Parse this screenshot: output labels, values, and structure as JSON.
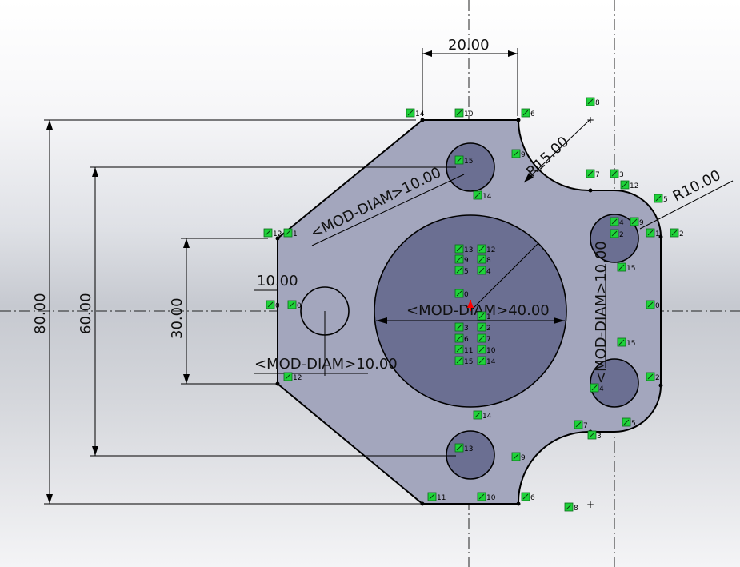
{
  "dimensions": {
    "width_top": "20.00",
    "height_outer": "80.00",
    "height_mid": "60.00",
    "height_inner": "30.00",
    "offset_small": "10.00",
    "radius_large_arc": "R15.00",
    "radius_small_arc": "R10.00",
    "diam_top": "<MOD-DIAM>10.00",
    "diam_center": "<MOD-DIAM>40.00",
    "diam_left": "<MOD-DIAM>10.00",
    "diam_right": "<MOD-DIAM>10.00"
  },
  "relation_tags": [
    {
      "id": "t1",
      "text": "14"
    },
    {
      "id": "t2",
      "text": "10"
    },
    {
      "id": "t3",
      "text": "6"
    },
    {
      "id": "t4",
      "text": "8"
    },
    {
      "id": "t5",
      "text": "9"
    },
    {
      "id": "t6",
      "text": "15"
    },
    {
      "id": "t7",
      "text": "14"
    },
    {
      "id": "t8",
      "text": "7"
    },
    {
      "id": "t9",
      "text": "3"
    },
    {
      "id": "t10",
      "text": "12"
    },
    {
      "id": "t11",
      "text": "5"
    },
    {
      "id": "t12",
      "text": "12"
    },
    {
      "id": "t13",
      "text": "1"
    },
    {
      "id": "t14",
      "text": "4"
    },
    {
      "id": "t15",
      "text": "9"
    },
    {
      "id": "t16",
      "text": "2"
    },
    {
      "id": "t17",
      "text": "1"
    },
    {
      "id": "t18",
      "text": "2"
    },
    {
      "id": "t19",
      "text": "15"
    },
    {
      "id": "t20",
      "text": "13"
    },
    {
      "id": "t21",
      "text": "12"
    },
    {
      "id": "t22",
      "text": "9"
    },
    {
      "id": "t23",
      "text": "8"
    },
    {
      "id": "t24",
      "text": "5"
    },
    {
      "id": "t25",
      "text": "4"
    },
    {
      "id": "t26",
      "text": "0"
    },
    {
      "id": "t27",
      "text": "0"
    },
    {
      "id": "t28",
      "text": "3"
    },
    {
      "id": "t29",
      "text": "2"
    },
    {
      "id": "t30",
      "text": "6"
    },
    {
      "id": "t31",
      "text": "7"
    },
    {
      "id": "t32",
      "text": "11"
    },
    {
      "id": "t33",
      "text": "10"
    },
    {
      "id": "t34",
      "text": "15"
    },
    {
      "id": "t35",
      "text": "14"
    },
    {
      "id": "t36",
      "text": "0"
    },
    {
      "id": "t37",
      "text": "0"
    },
    {
      "id": "t38",
      "text": "15"
    },
    {
      "id": "t39",
      "text": "2"
    },
    {
      "id": "t40",
      "text": "4"
    },
    {
      "id": "t41",
      "text": "12"
    },
    {
      "id": "t42",
      "text": "14"
    },
    {
      "id": "t43",
      "text": "7"
    },
    {
      "id": "t44",
      "text": "5"
    },
    {
      "id": "t45",
      "text": "3"
    },
    {
      "id": "t46",
      "text": "13"
    },
    {
      "id": "t47",
      "text": "9"
    },
    {
      "id": "t48",
      "text": "11"
    },
    {
      "id": "t49",
      "text": "10"
    },
    {
      "id": "t50",
      "text": "6"
    },
    {
      "id": "t51",
      "text": "8"
    },
    {
      "id": "t52",
      "text": "1"
    }
  ],
  "colors": {
    "part_fill": "#a3a6bd",
    "hole_fill": "#6b6f92",
    "outline": "#000000",
    "relation_green": "#1fd33a",
    "origin_red": "#ff0000"
  }
}
